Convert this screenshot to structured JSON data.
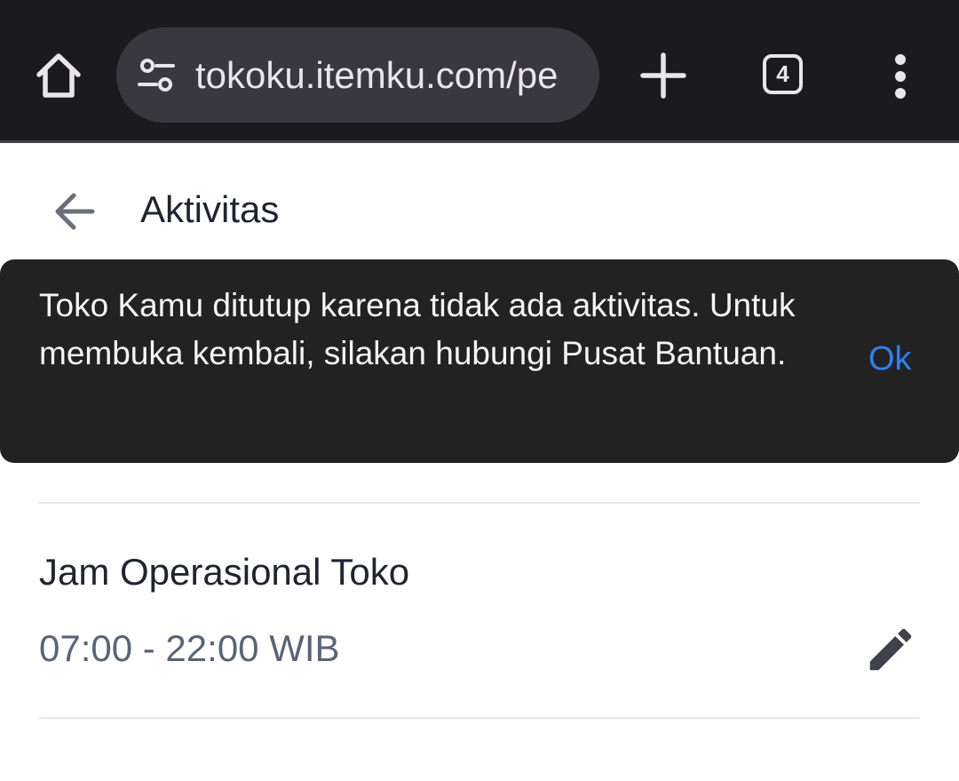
{
  "browser": {
    "url": "tokoku.itemku.com/pe",
    "tab_count": "4",
    "icons": {
      "home": "home-icon",
      "site_settings": "tune-icon",
      "new_tab": "plus-icon",
      "menu": "more-vert-icon"
    }
  },
  "header": {
    "title": "Aktivitas",
    "back_icon": "arrow-back-icon"
  },
  "snackbar": {
    "message": "Toko Kamu ditutup karena tidak ada aktivitas. Untuk membuka kembali, silakan hubungi Pusat Bantuan.",
    "action_label": "Ok",
    "action_color": "#2f80ed"
  },
  "operating_hours": {
    "title": "Jam Operasional Toko",
    "value": "07:00 - 22:00 WIB",
    "edit_icon": "pencil-icon"
  }
}
